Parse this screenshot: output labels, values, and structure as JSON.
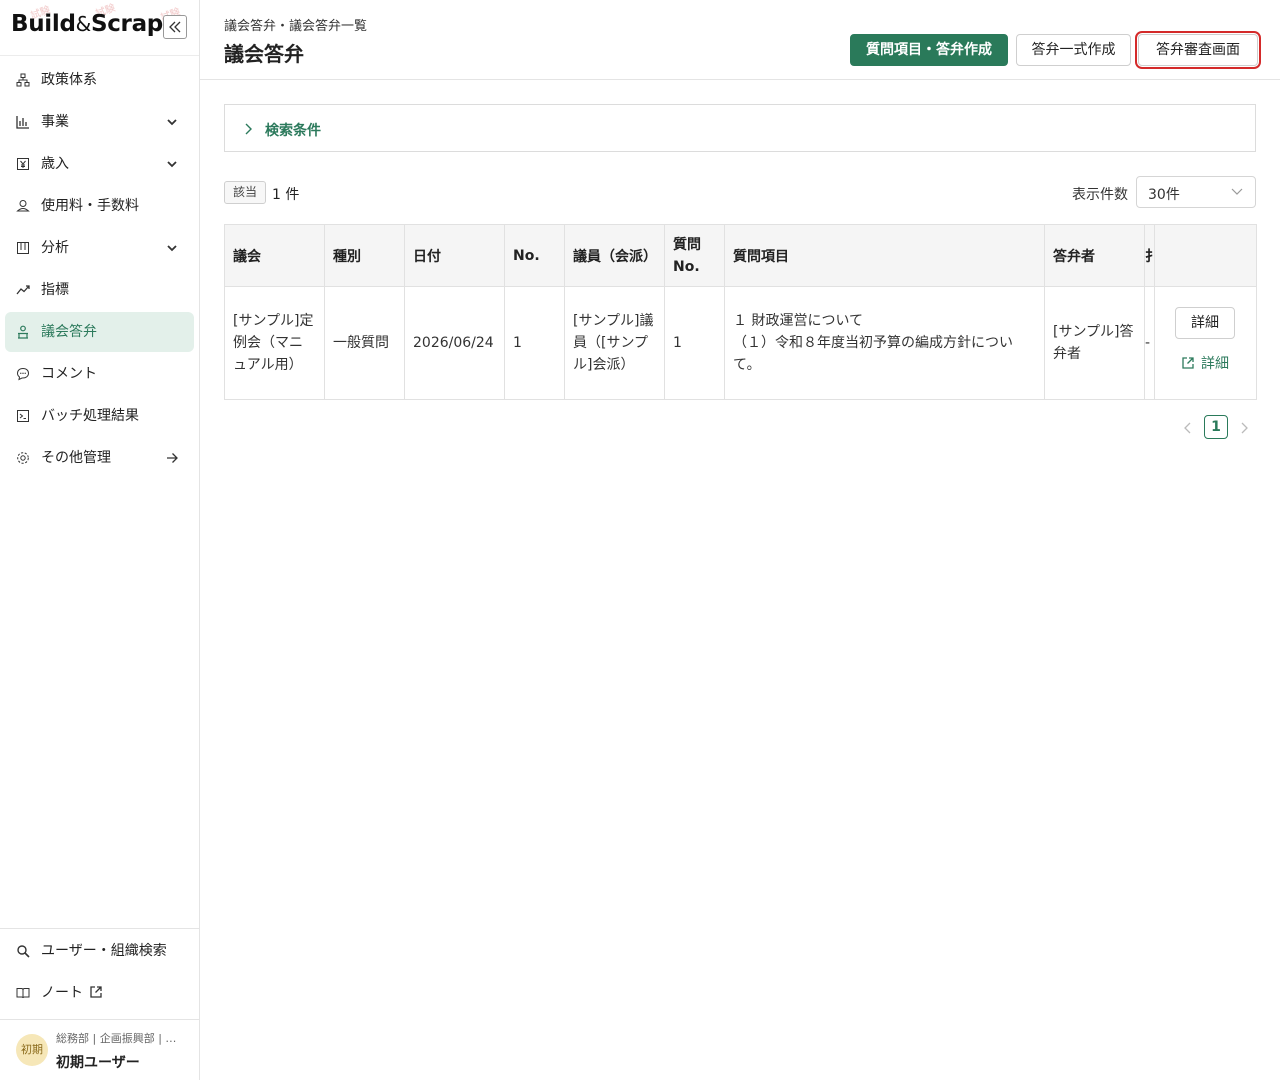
{
  "app": {
    "logo_left": "Build",
    "logo_amp": "&",
    "logo_right": "Scrap"
  },
  "sidebar": {
    "items": [
      {
        "label": "政策体系",
        "icon": "hierarchy-icon",
        "expandable": false
      },
      {
        "label": "事業",
        "icon": "bar-chart-icon",
        "expandable": true
      },
      {
        "label": "歳入",
        "icon": "yen-icon",
        "expandable": true
      },
      {
        "label": "使用料・手数料",
        "icon": "coins-icon",
        "expandable": false
      },
      {
        "label": "分析",
        "icon": "board-icon",
        "expandable": true
      },
      {
        "label": "指標",
        "icon": "trend-icon",
        "expandable": false
      },
      {
        "label": "議会答弁",
        "icon": "podium-icon",
        "expandable": false,
        "active": true
      },
      {
        "label": "コメント",
        "icon": "comment-icon",
        "expandable": false
      },
      {
        "label": "バッチ処理結果",
        "icon": "terminal-icon",
        "expandable": false
      },
      {
        "label": "その他管理",
        "icon": "gear-icon",
        "expandable": false,
        "arrow": true
      }
    ],
    "bottom": [
      {
        "label": "ユーザー・組織検索",
        "icon": "search-icon"
      },
      {
        "label": "ノート",
        "icon": "book-icon",
        "external": true
      }
    ],
    "user": {
      "avatar": "初期",
      "dept": "総務部 | 企画振興部 | …",
      "name": "初期ユーザー"
    }
  },
  "header": {
    "breadcrumb": "議会答弁・議会答弁一覧",
    "title": "議会答弁",
    "buttons": {
      "create_items": "質問項目・答弁作成",
      "bulk_create": "答弁一式作成",
      "review": "答弁審査画面"
    }
  },
  "search": {
    "label": "検索条件"
  },
  "results": {
    "hit_label": "該当",
    "count_text": "1 件",
    "per_page_label": "表示件数",
    "per_page_value": "30件"
  },
  "table": {
    "headers": {
      "council": "議会",
      "type": "種別",
      "date": "日付",
      "no": "No.",
      "member": "議員（会派）",
      "qno_1": "質問",
      "qno_2": "No.",
      "item": "質問項目",
      "answerer": "答弁者",
      "clipped": "扌"
    },
    "rows": [
      {
        "council": "[サンプル]定例会（マニュアル用）",
        "type": "一般質問",
        "date": "2026/06/24",
        "no": "1",
        "member": "[サンプル]議員（[サンプル]会派）",
        "qno": "1",
        "item_line1": "１ 財政運営について",
        "item_line2": "（１）令和８年度当初予算の編成方針について。",
        "answerer": "[サンプル]答弁者",
        "clipped": "-",
        "detail_button": "詳細",
        "detail_link": "詳細"
      }
    ]
  },
  "pagination": {
    "current": "1"
  }
}
